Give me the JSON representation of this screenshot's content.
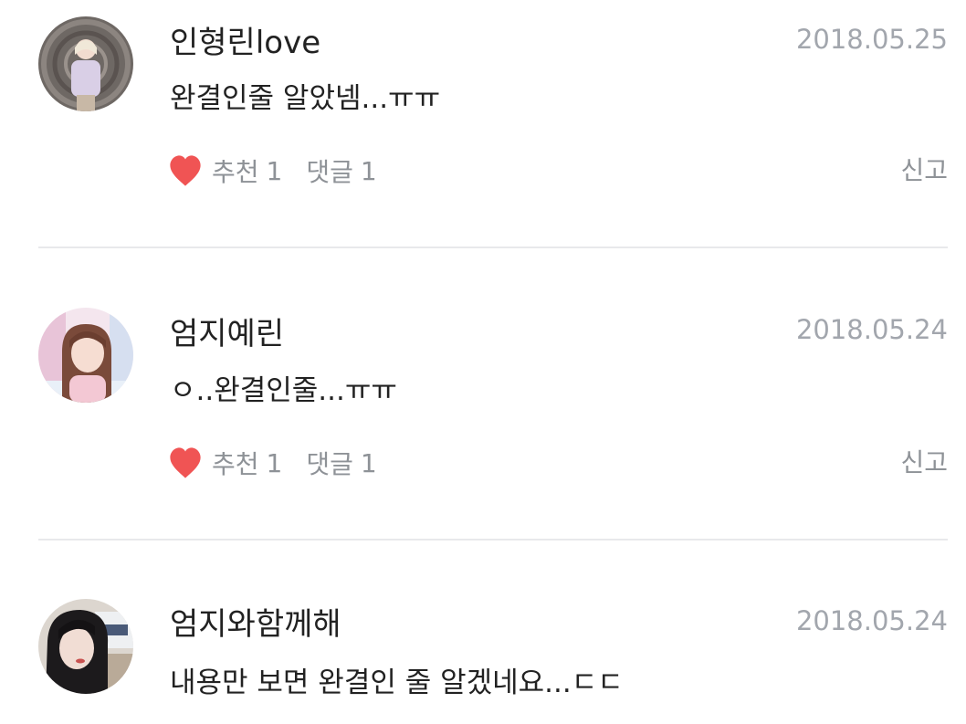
{
  "comments": [
    {
      "username": "인형린love",
      "date": "2018.05.25",
      "text": "완결인줄 알았넴...ㅠㅠ",
      "like_label": "추천",
      "like_count": "1",
      "reply_label": "댓글",
      "reply_count": "1",
      "report_label": "신고"
    },
    {
      "username": "엄지예린",
      "date": "2018.05.24",
      "text": "ㅇ..완결인줄...ㅠㅠ",
      "like_label": "추천",
      "like_count": "1",
      "reply_label": "댓글",
      "reply_count": "1",
      "report_label": "신고"
    },
    {
      "username": "엄지와함께해",
      "date": "2018.05.24",
      "text": "내용만 보면 완결인 줄 알겠네요...ㄷㄷ"
    }
  ],
  "icons": {
    "like": "heart-icon"
  },
  "colors": {
    "heart": "#f05454",
    "meta_text": "#8e9297",
    "date_text": "#a2a6ad",
    "divider": "#e8e9eb"
  }
}
